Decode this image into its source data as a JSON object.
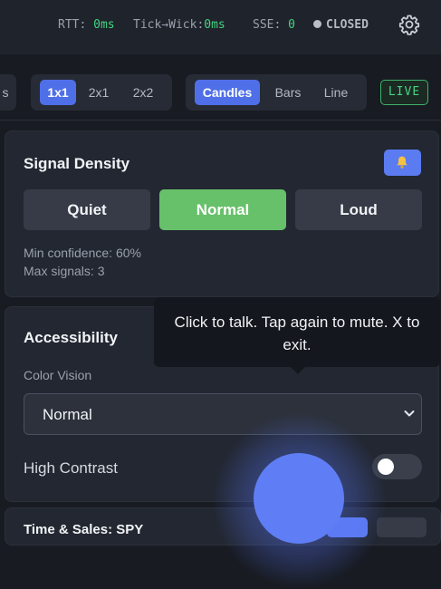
{
  "status": {
    "rtt_label": "RTT:",
    "rtt_value": "0ms",
    "tick_label": "Tick→Wick:",
    "tick_value": "0ms",
    "sse_label": "SSE:",
    "sse_value": "0",
    "connection": "CLOSED",
    "settings_icon": "gear-icon"
  },
  "toolbar": {
    "left_partial": "s",
    "layouts": [
      {
        "label": "1x1",
        "active": true
      },
      {
        "label": "2x1",
        "active": false
      },
      {
        "label": "2x2",
        "active": false
      }
    ],
    "chart_types": [
      {
        "label": "Candles",
        "active": true
      },
      {
        "label": "Bars",
        "active": false
      },
      {
        "label": "Line",
        "active": false
      }
    ],
    "live_label": "LIVE",
    "colors": {
      "accent": "#4f6fe8",
      "live": "#45d483"
    }
  },
  "signal_density": {
    "title": "Signal Density",
    "bell_icon": "bell-icon",
    "options": [
      {
        "label": "Quiet",
        "active": false
      },
      {
        "label": "Normal",
        "active": true
      },
      {
        "label": "Loud",
        "active": false
      }
    ],
    "min_confidence": "Min confidence: 60%",
    "max_signals": "Max signals: 3",
    "colors": {
      "active": "#67c06a"
    }
  },
  "accessibility": {
    "title": "Accessibility",
    "color_vision_label": "Color Vision",
    "color_vision_value": "Normal",
    "high_contrast_label": "High Contrast",
    "high_contrast_on": false
  },
  "tooltip": {
    "text": "Click to talk. Tap again to mute. X to exit."
  },
  "next_card": {
    "title": "Time & Sales: SPY"
  }
}
